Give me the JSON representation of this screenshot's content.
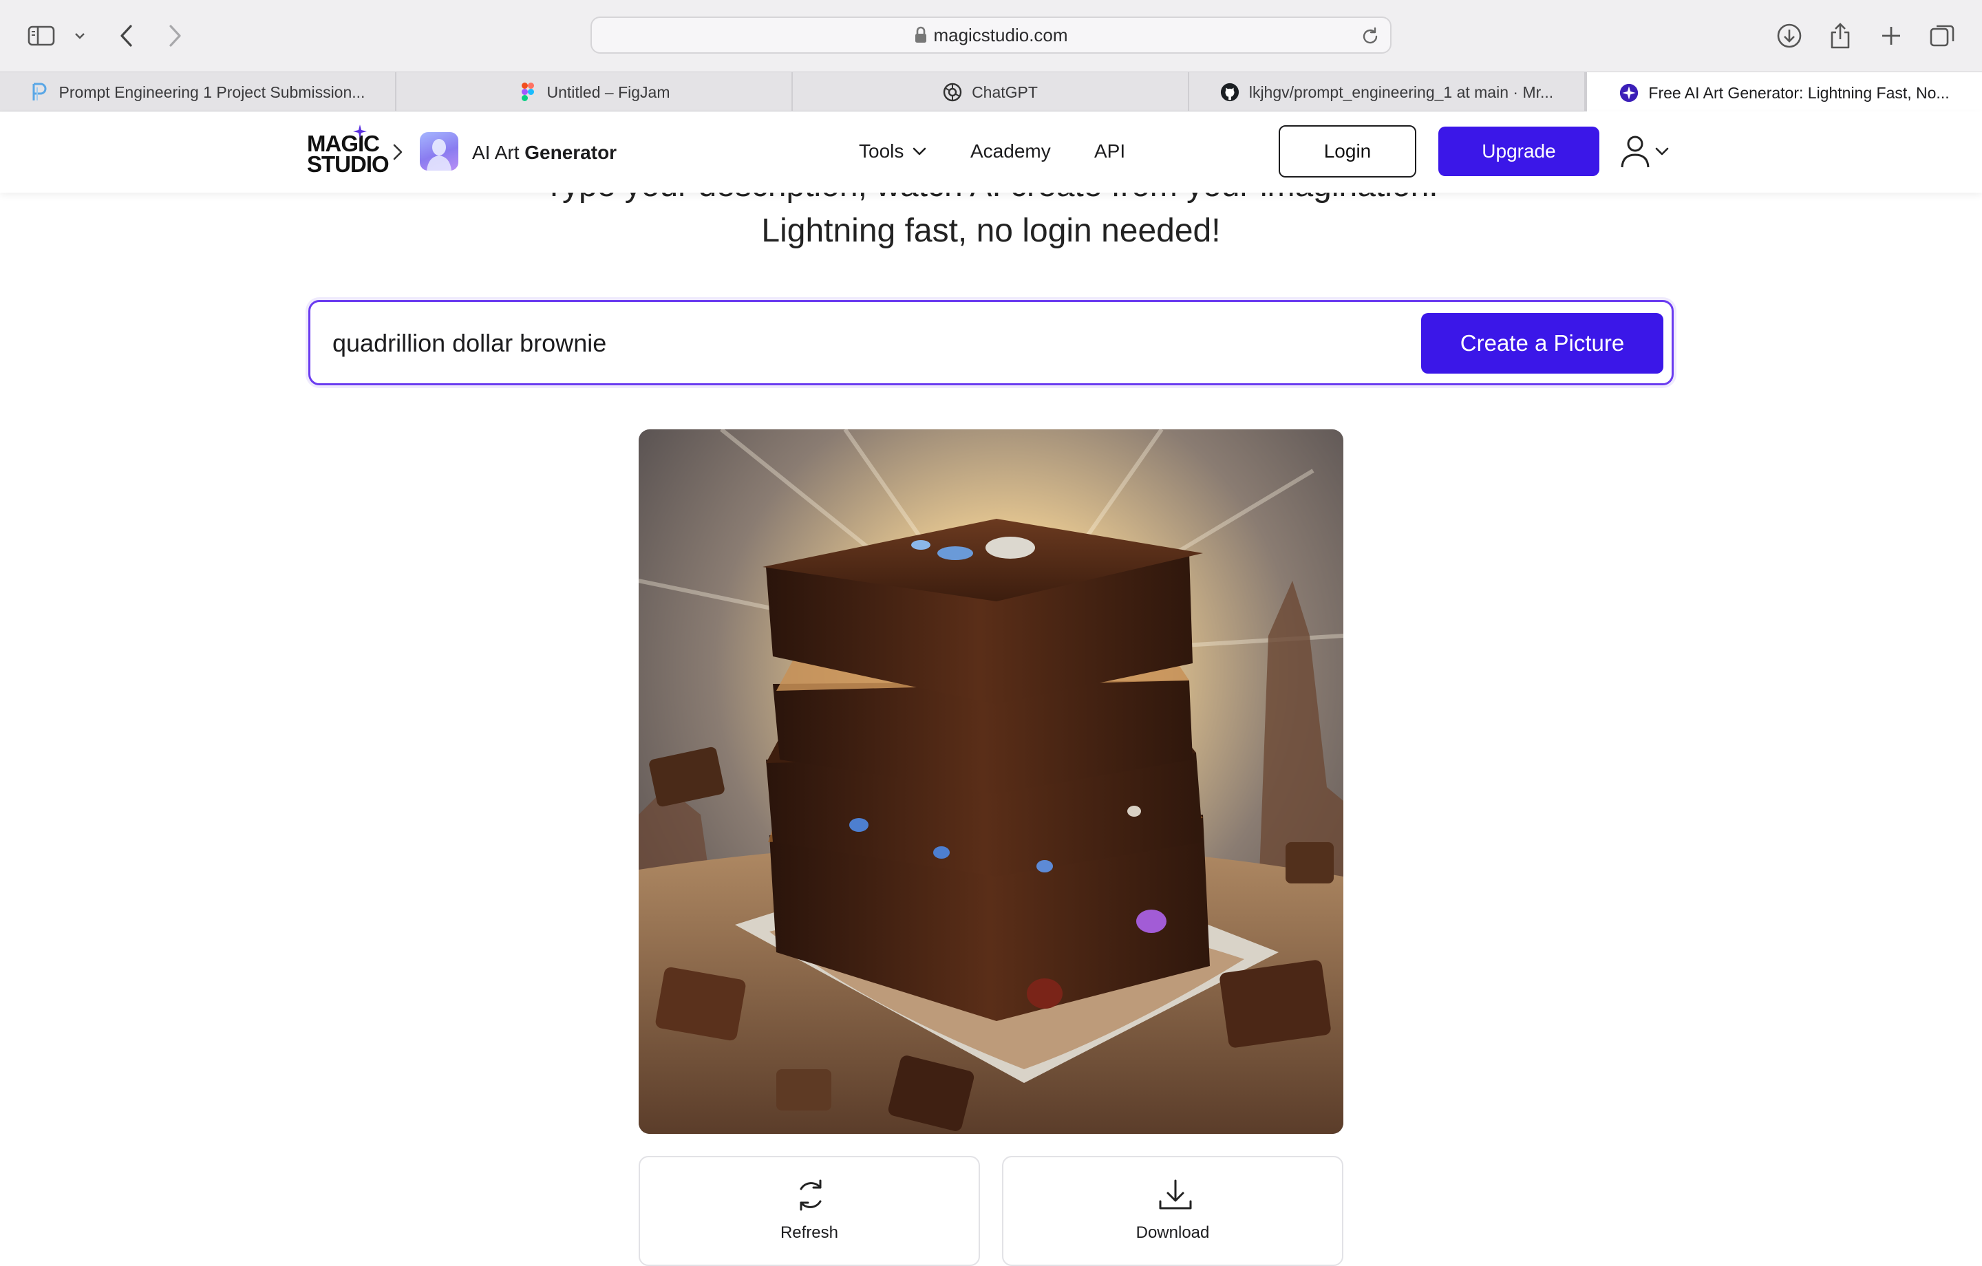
{
  "browser": {
    "url": "magicstudio.com",
    "tabs": [
      {
        "label": "Prompt Engineering 1 Project Submission...",
        "icon": "p-logo-icon"
      },
      {
        "label": "Untitled – FigJam",
        "icon": "figma-icon"
      },
      {
        "label": "ChatGPT",
        "icon": "chatgpt-icon"
      },
      {
        "label": "lkjhgv/prompt_engineering_1 at main · Mr...",
        "icon": "github-icon"
      },
      {
        "label": "Free AI Art Generator: Lightning Fast, No...",
        "icon": "magic-studio-icon",
        "active": true
      }
    ]
  },
  "header": {
    "logo_line_1": "MAGIC",
    "logo_line_2": "STUDIO",
    "product_name_light": "AI Art",
    "product_name_bold": "Generator",
    "nav": {
      "tools": "Tools",
      "academy": "Academy",
      "api": "API"
    },
    "login_label": "Login",
    "upgrade_label": "Upgrade"
  },
  "hero": {
    "line1": "Type your description, watch AI create from your imagination.",
    "line2": "Lightning fast, no login needed!"
  },
  "prompt": {
    "value": "quadrillion dollar brownie",
    "button_label": "Create a Picture"
  },
  "actions": {
    "refresh_label": "Refresh",
    "download_label": "Download"
  },
  "colors": {
    "brand": "#3b17e8",
    "prompt_border": "#6b3cf0"
  }
}
